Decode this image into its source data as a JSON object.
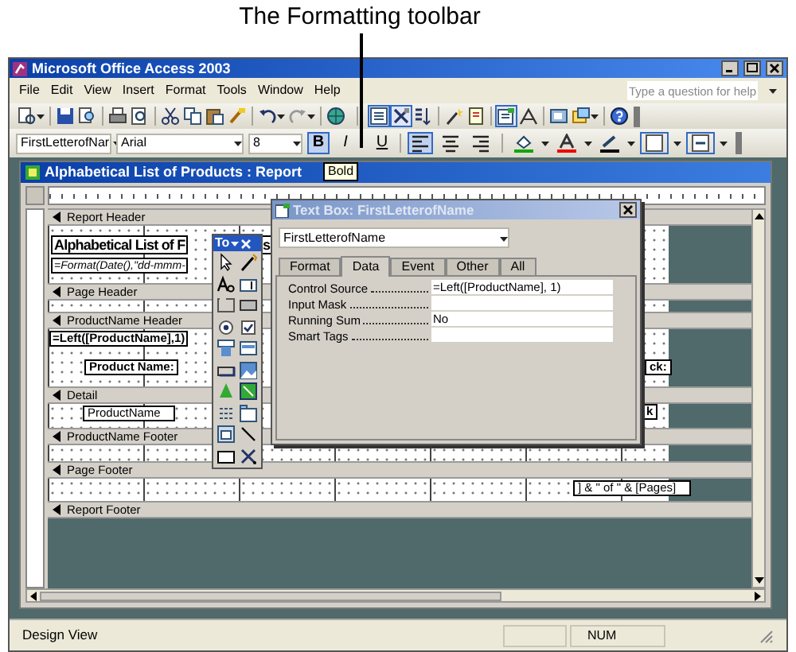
{
  "annotation": {
    "caption": "The Formatting toolbar"
  },
  "app_window": {
    "title": "Microsoft Office Access 2003"
  },
  "menu_bar": {
    "items": [
      "File",
      "Edit",
      "View",
      "Insert",
      "Format",
      "Tools",
      "Window",
      "Help"
    ],
    "help_box": {
      "placeholder": "Type a question for help"
    }
  },
  "standard_toolbar": [
    {
      "kind": "view",
      "on": false,
      "menu": true
    },
    {
      "kind": "save",
      "on": false,
      "menu": false
    },
    {
      "kind": "search",
      "on": false,
      "menu": false
    },
    {
      "kind": "print",
      "on": false,
      "menu": false
    },
    {
      "kind": "preview",
      "on": false,
      "menu": false
    },
    {
      "kind": "cut",
      "on": false,
      "menu": false
    },
    {
      "kind": "copy",
      "on": false,
      "menu": false
    },
    {
      "kind": "paste",
      "on": false,
      "menu": false
    },
    {
      "kind": "painter",
      "on": false,
      "menu": false
    },
    {
      "kind": "undo",
      "on": false,
      "menu": true
    },
    {
      "kind": "redo",
      "on": false,
      "menu": true
    },
    {
      "kind": "hyperlink",
      "on": false,
      "menu": false
    },
    {
      "kind": "field_list",
      "on": true,
      "menu": false
    },
    {
      "kind": "toolbox",
      "on": true,
      "menu": false
    },
    {
      "kind": "sorting",
      "on": false,
      "menu": false
    },
    {
      "kind": "autoformat",
      "on": false,
      "menu": false
    },
    {
      "kind": "code",
      "on": false,
      "menu": false
    },
    {
      "kind": "properties",
      "on": true,
      "menu": false
    },
    {
      "kind": "build",
      "on": false,
      "menu": false
    },
    {
      "kind": "database",
      "on": false,
      "menu": false
    },
    {
      "kind": "new_object",
      "on": false,
      "menu": true
    },
    {
      "kind": "help",
      "on": false,
      "menu": false
    }
  ],
  "formatting_toolbar": {
    "object_box": "FirstLetterofNar",
    "font_box": "Arial",
    "size_box": "8",
    "style_buttons": [
      {
        "label": "B",
        "on": true
      },
      {
        "label": "I",
        "on": false
      },
      {
        "label": "U",
        "on": false
      }
    ],
    "alignment_buttons": [
      {
        "kind": "left",
        "on": true
      },
      {
        "kind": "center",
        "on": false
      },
      {
        "kind": "right",
        "on": false
      }
    ]
  },
  "tooltip": {
    "text": "Bold"
  },
  "report_window": {
    "title": "Alphabetical List of Products : Report",
    "sections": [
      {
        "label": "Report Header",
        "controls": [
          {
            "kind": "title",
            "text": "Alphabetical List of F"
          },
          {
            "kind": "title",
            "text": "s"
          },
          {
            "kind": "expression",
            "text": "=Format(Date(),\"dd-mmm-"
          }
        ]
      },
      {
        "label": "Page Header"
      },
      {
        "label": "ProductName Header",
        "controls": [
          {
            "kind": "expression_bold",
            "text": "=Left([ProductName],1)"
          },
          {
            "kind": "label",
            "text": "Product Name:"
          },
          {
            "kind": "label",
            "text": "ck:"
          }
        ]
      },
      {
        "label": "Detail",
        "controls": [
          {
            "kind": "field",
            "text": "ProductName"
          },
          {
            "kind": "label",
            "text": "k"
          }
        ]
      },
      {
        "label": "ProductName Footer"
      },
      {
        "label": "Page Footer",
        "controls": [
          {
            "kind": "field",
            "text": "] & \" of \" & [Pages]"
          }
        ]
      },
      {
        "label": "Report Footer"
      }
    ]
  },
  "toolbox": {
    "title": "To"
  },
  "property_sheet": {
    "title": "Text Box: FirstLetterofName",
    "active": false,
    "object_box": "FirstLetterofName",
    "tabs": [
      {
        "label": "Format",
        "selected": false
      },
      {
        "label": "Data",
        "selected": true
      },
      {
        "label": "Event",
        "selected": false
      },
      {
        "label": "Other",
        "selected": false
      },
      {
        "label": "All",
        "selected": false
      }
    ],
    "properties": [
      {
        "name": "Control Source",
        "value": "=Left([ProductName], 1)"
      },
      {
        "name": "Input Mask"
      },
      {
        "name": "Running Sum",
        "value": "No"
      },
      {
        "name": "Smart Tags"
      }
    ]
  },
  "status_bar": {
    "mode": "Design View",
    "indicator": "NUM"
  }
}
